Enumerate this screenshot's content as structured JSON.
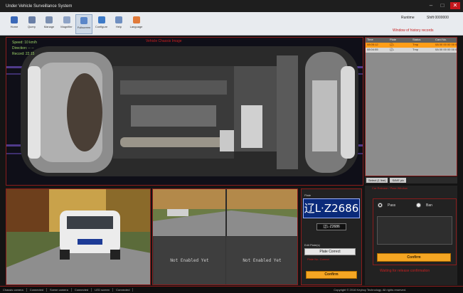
{
  "window": {
    "title": "Under Vehicle Surveillance System",
    "controls": [
      "minimize",
      "maximize",
      "close"
    ]
  },
  "toolbar": {
    "items": [
      {
        "label": "Home",
        "color": "#3a68b8"
      },
      {
        "label": "Query",
        "color": "#6a7fa6"
      },
      {
        "label": "Manage",
        "color": "#7b8fb0"
      },
      {
        "label": "Magnifier",
        "color": "#8ea3c6"
      },
      {
        "label": "Fullscreen",
        "color": "#5a86c8"
      },
      {
        "label": "Configure",
        "color": "#3d7ac7"
      },
      {
        "label": "Help",
        "color": "#6f8fc0"
      },
      {
        "label": "Language",
        "color": "#e07a3a"
      }
    ],
    "active_index": 4
  },
  "header": {
    "runtime_label": "Runtime",
    "shift_label": "Shift 0000000",
    "history_title": "Window of history records"
  },
  "main_view": {
    "title": "Vehicle Chassis Image",
    "overlay": {
      "speed": "Speed: 10 km/h",
      "direction": "Direction: -- --",
      "record": "Record: 22 15"
    }
  },
  "history": {
    "columns": [
      "Time",
      "Plate",
      "Status",
      "Card No."
    ],
    "rows": [
      {
        "time": "08:05:12",
        "plate": "辽L",
        "status": "Tmp",
        "card": "0A 00 00 00 00 00"
      },
      {
        "time": "08:04:55",
        "plate": "辽L",
        "status": "Tmp",
        "card": "0A 00 00 00 00 00"
      }
    ],
    "filter": [
      "Select (1 line)",
      "SAVE pic"
    ]
  },
  "cameras": {
    "not_enabled": "Not Enabled Yet"
  },
  "plate": {
    "label": "Plate",
    "image_text": "辽L·Z2686",
    "text": "辽L·Z2686",
    "edit_label": "Edit Plate(s)",
    "correct_button": "Plate Correct",
    "red_note": "Plate No. Correct",
    "confirm_button": "Confirm"
  },
  "pass": {
    "title": "Car Release / Pass Window",
    "pass_label": "Pass",
    "ban_label": "Ban",
    "confirm_button": "Confirm",
    "note": "Waiting for release confirmation"
  },
  "status": {
    "items": [
      "Chassis camera",
      "Connected",
      "Scene camera",
      "Connected",
      "LED screen",
      "Connected"
    ],
    "copyright": "Copyright © 2016 Keyboy Technology. All rights reserved."
  }
}
